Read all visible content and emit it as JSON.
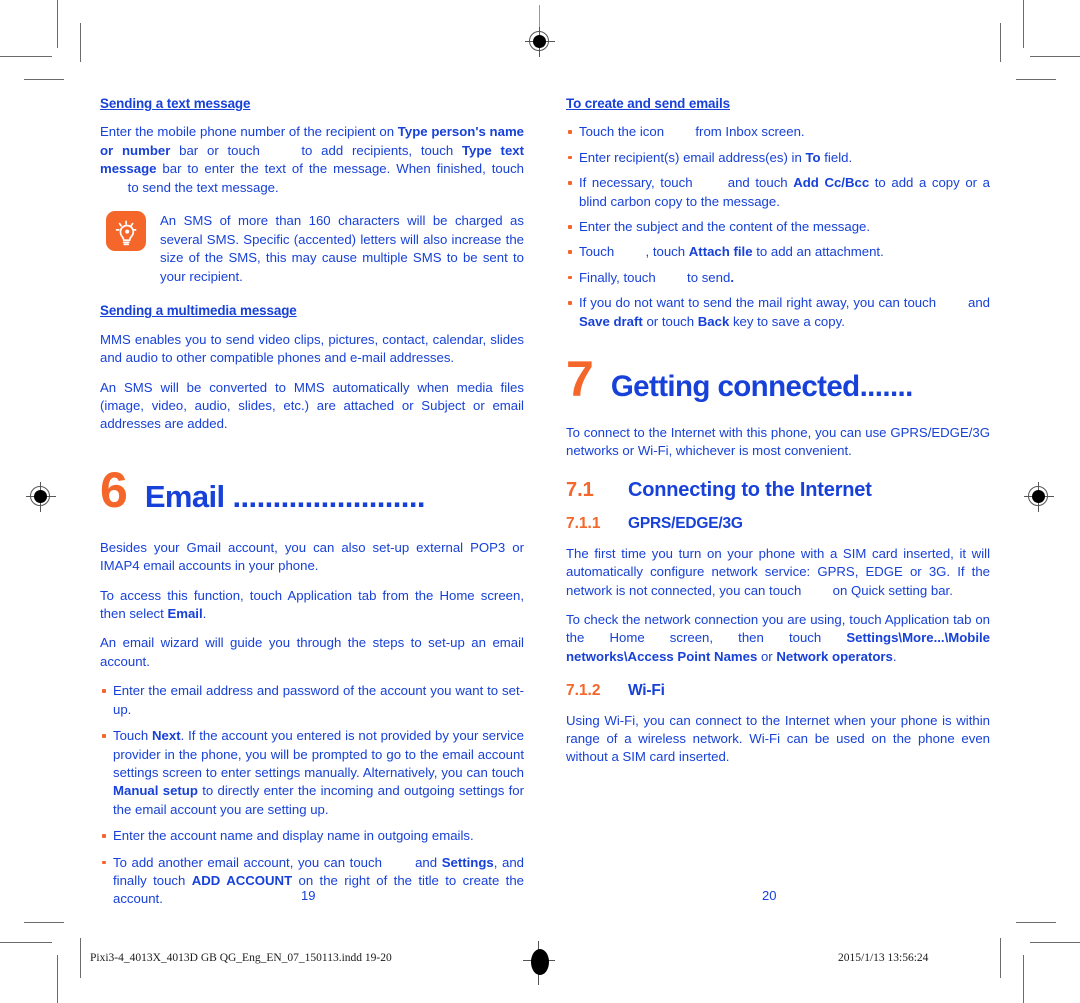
{
  "document": {
    "footer_file": "Pixi3-4_4013X_4013D GB QG_Eng_EN_07_150113.indd   19-20",
    "footer_timestamp": "2015/1/13   13:56:24",
    "page_left": "19",
    "page_right": "20"
  },
  "colors": {
    "blue": "#1741d8",
    "orange": "#f4662a",
    "text_black": "#1b1b1b"
  },
  "left_column": {
    "heading_text_message": "Sending a text message",
    "para_send_text": {
      "p1": "Enter the mobile phone number of the recipient on ",
      "b1": "Type person's name or number",
      "p2": " bar or touch ",
      "p3": " to add recipients, touch ",
      "b2": "Type text message",
      "p4": " bar to enter the text of the message. When finished, touch ",
      "p5": " to send the text message."
    },
    "tip": {
      "icon": "lightbulb-icon",
      "text": "An SMS of more than 160 characters will be charged as several SMS. Specific (accented) letters will also increase the size of the SMS, this may cause multiple SMS to be sent to your recipient."
    },
    "heading_multimedia": "Sending a multimedia message",
    "para_mms_1": "MMS enables you to send video clips, pictures, contact, calendar, slides and audio to other compatible phones and e-mail addresses.",
    "para_mms_2": "An SMS will be converted to MMS automatically when media files (image, video, audio, slides, etc.) are attached or Subject or email addresses are added.",
    "chapter": {
      "number": "6",
      "title": "Email ........................"
    },
    "para_email_1": "Besides your Gmail account, you can also set-up external POP3 or IMAP4 email accounts in your phone.",
    "para_email_2": {
      "p1": "To access this function, touch Application tab from the Home screen, then select ",
      "b1": "Email",
      "p2": "."
    },
    "para_email_3": "An email wizard will guide you through the steps to set-up an email account.",
    "bullets": [
      {
        "p1": "Enter the email address and password of the account you want to set-up."
      },
      {
        "p1": "Touch ",
        "b1": "Next",
        "p2": ". If the account you entered is not provided by your service provider in the phone, you will be prompted to go to the email account settings screen to enter settings manually. Alternatively, you can touch ",
        "b2": "Manual setup",
        "p3": " to directly enter the incoming and outgoing settings for the email account you are setting up."
      },
      {
        "p1": "Enter the account name and display name in outgoing emails."
      },
      {
        "p1": "To add another email account, you can touch ",
        "p2": " and ",
        "b1": "Settings",
        "p3": ", and finally touch ",
        "b2": "ADD ACCOUNT",
        "p4": " on the right of the title to create the account."
      }
    ]
  },
  "right_column": {
    "heading_create_emails": "To create and send emails",
    "bullets": [
      {
        "p1": "Touch the icon ",
        "p2": " from Inbox screen."
      },
      {
        "p1": "Enter recipient(s) email address(es) in ",
        "b1": "To",
        "p2": " field."
      },
      {
        "p1": "If necessary, touch ",
        "p2": " and touch ",
        "b1": "Add Cc/Bcc",
        "p3": " to add a copy or a blind carbon copy to the message."
      },
      {
        "p1": "Enter the subject and the content of the message."
      },
      {
        "p1": "Touch ",
        "p2": " , touch ",
        "b1": "Attach file",
        "p3": " to add an attachment."
      },
      {
        "p1": "Finally, touch ",
        "p2": " to send",
        "b1": ".",
        "p3": ""
      },
      {
        "p1": "If you do not want to send the mail right away, you can touch ",
        "p2": " and ",
        "b1": "Save draft",
        "p3": " or touch ",
        "b2": "Back",
        "p4": " key to save a copy."
      }
    ],
    "chapter": {
      "number": "7",
      "title": "Getting connected......."
    },
    "para_intro": "To connect to the Internet with this phone, you can use GPRS/EDGE/3G networks or Wi-Fi, whichever is most convenient.",
    "section_7_1": {
      "number": "7.1",
      "title": "Connecting to the Internet"
    },
    "section_7_1_1": {
      "number": "7.1.1",
      "title": "GPRS/EDGE/3G"
    },
    "para_gprs_1": {
      "p1": "The first time you turn on your phone with a SIM card inserted, it will automatically configure network service: GPRS, EDGE or 3G. If the network is not connected, you can touch ",
      "p2": " on Quick setting bar."
    },
    "para_gprs_2": {
      "p1": "To check the network connection you are using, touch Application tab on the Home screen, then touch ",
      "b1": "Settings\\More...\\Mobile networks\\Access Point Names",
      "p2": " or ",
      "b2": "Network operators",
      "p3": "."
    },
    "section_7_1_2": {
      "number": "7.1.2",
      "title": "Wi-Fi"
    },
    "para_wifi": "Using Wi-Fi, you can connect to the Internet when your phone is within range of a wireless network. Wi-Fi can be used on the phone even without a SIM card inserted."
  }
}
